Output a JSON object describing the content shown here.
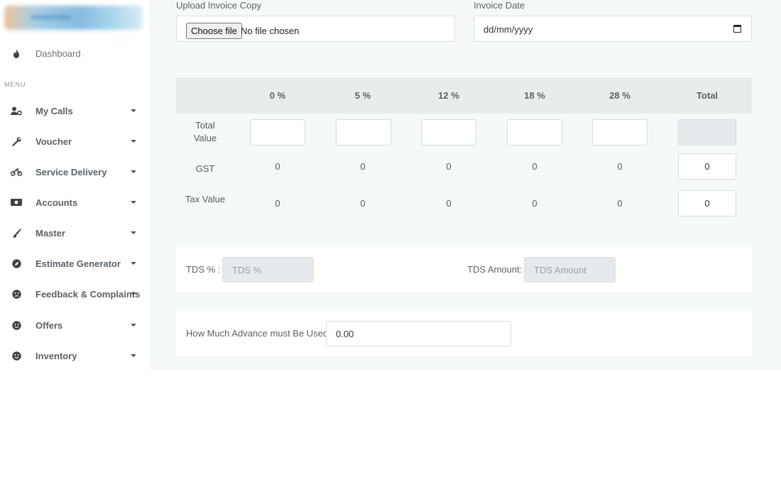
{
  "sidebar": {
    "dashboard": "Dashboard",
    "menu_heading": "MENU",
    "items": [
      {
        "label": "My Calls",
        "icon": "user-cog-icon"
      },
      {
        "label": "Voucher",
        "icon": "wrench-icon"
      },
      {
        "label": "Service Delivery",
        "icon": "motorcycle-icon"
      },
      {
        "label": "Accounts",
        "icon": "money-bill-icon"
      },
      {
        "label": "Master",
        "icon": "brush-icon"
      },
      {
        "label": "Estimate Generator",
        "icon": "compass-icon"
      },
      {
        "label": "Feedback & Complaints",
        "icon": "frown-icon"
      },
      {
        "label": "Offers",
        "icon": "smile-icon"
      },
      {
        "label": "Inventory",
        "icon": "smile-icon"
      }
    ]
  },
  "form": {
    "upload_label": "Upload Invoice Copy",
    "choose_file": "Choose file",
    "no_file": "No file chosen",
    "date_label": "Invoice Date",
    "date_placeholder": "dd/mm/yyyy"
  },
  "gst_table": {
    "headers": [
      "0 %",
      "5 %",
      "12 %",
      "18 %",
      "28 %",
      "Total"
    ],
    "total_value_label": "Total Value",
    "gst_label": "GST",
    "tax_value_label": "Tax Value",
    "gst_values": [
      "0",
      "0",
      "0",
      "0",
      "0"
    ],
    "gst_total": "0",
    "tax_values": [
      "0",
      "0",
      "0",
      "0",
      "0"
    ],
    "tax_total": "0"
  },
  "tds": {
    "percent_label": "TDS % :",
    "percent_placeholder": "TDS %",
    "amount_label": "TDS Amount:",
    "amount_placeholder": "TDS Amount"
  },
  "advance": {
    "label": "How Much Advance must Be Used:",
    "value": "0.00"
  }
}
